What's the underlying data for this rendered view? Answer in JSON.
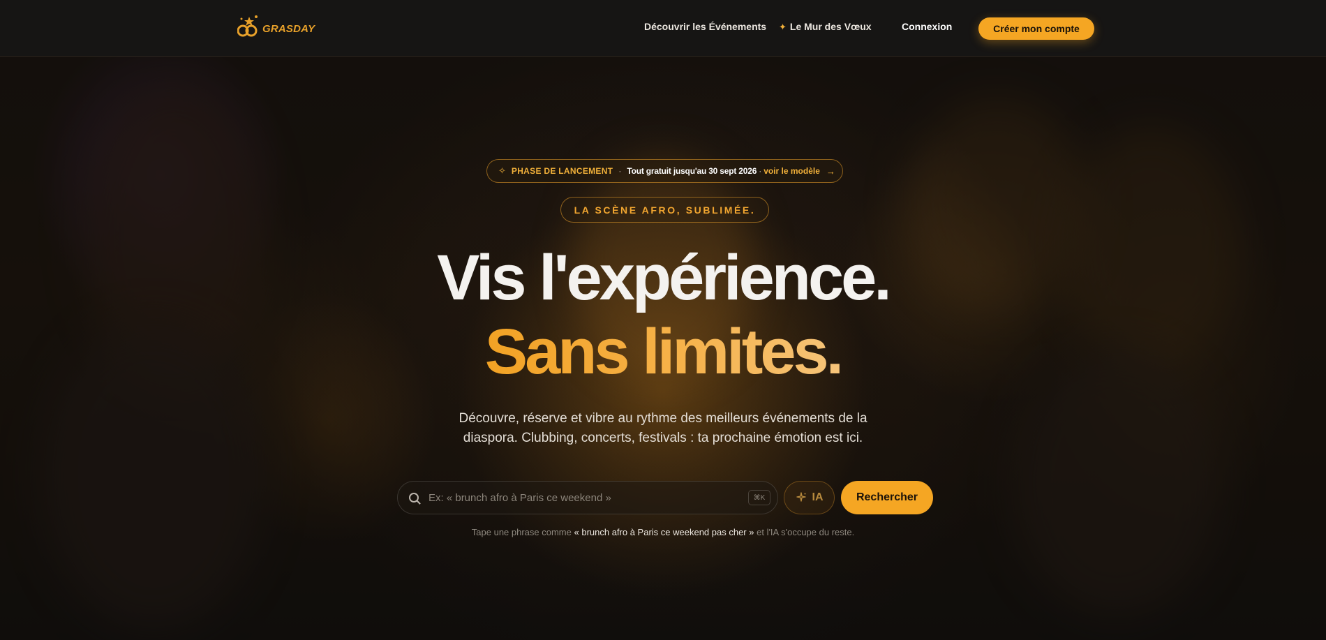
{
  "brand": {
    "name": "GRASDAY"
  },
  "nav": {
    "discover": "Découvrir les Événements",
    "wall": "Le Mur des Vœux",
    "login": "Connexion",
    "signup": "Créer mon compte"
  },
  "hero": {
    "launch": {
      "phase": "PHASE DE LANCEMENT",
      "dot": "·",
      "free": "Tout gratuit jusqu'au 30 sept 2026",
      "sep": "·",
      "model": "voir le modèle"
    },
    "tagline": "LA SCÈNE AFRO, SUBLIMÉE.",
    "title_line1": "Vis l'expérience.",
    "title_line2": "Sans limites.",
    "subtitle_line1": "Découvre, réserve et vibre au rythme des meilleurs événements de la",
    "subtitle_line2": "diaspora. Clubbing, concerts, festivals : ta prochaine émotion est ici."
  },
  "search": {
    "placeholder": "Ex: « brunch afro à Paris ce weekend »",
    "shortcut": "⌘K",
    "ia_label": "IA",
    "button": "Rechercher",
    "hint_prefix": "Tape une phrase comme",
    "hint_example": "« brunch afro à Paris ce weekend pas cher »",
    "hint_suffix": "et l'IA s'occupe du reste."
  },
  "colors": {
    "accent": "#f5a623",
    "header_bg": "#161514",
    "title_white": "#f4f2ef"
  },
  "icons": [
    "sparkles-icon",
    "arrow-right-icon",
    "search-icon",
    "magic-wand-icon"
  ]
}
